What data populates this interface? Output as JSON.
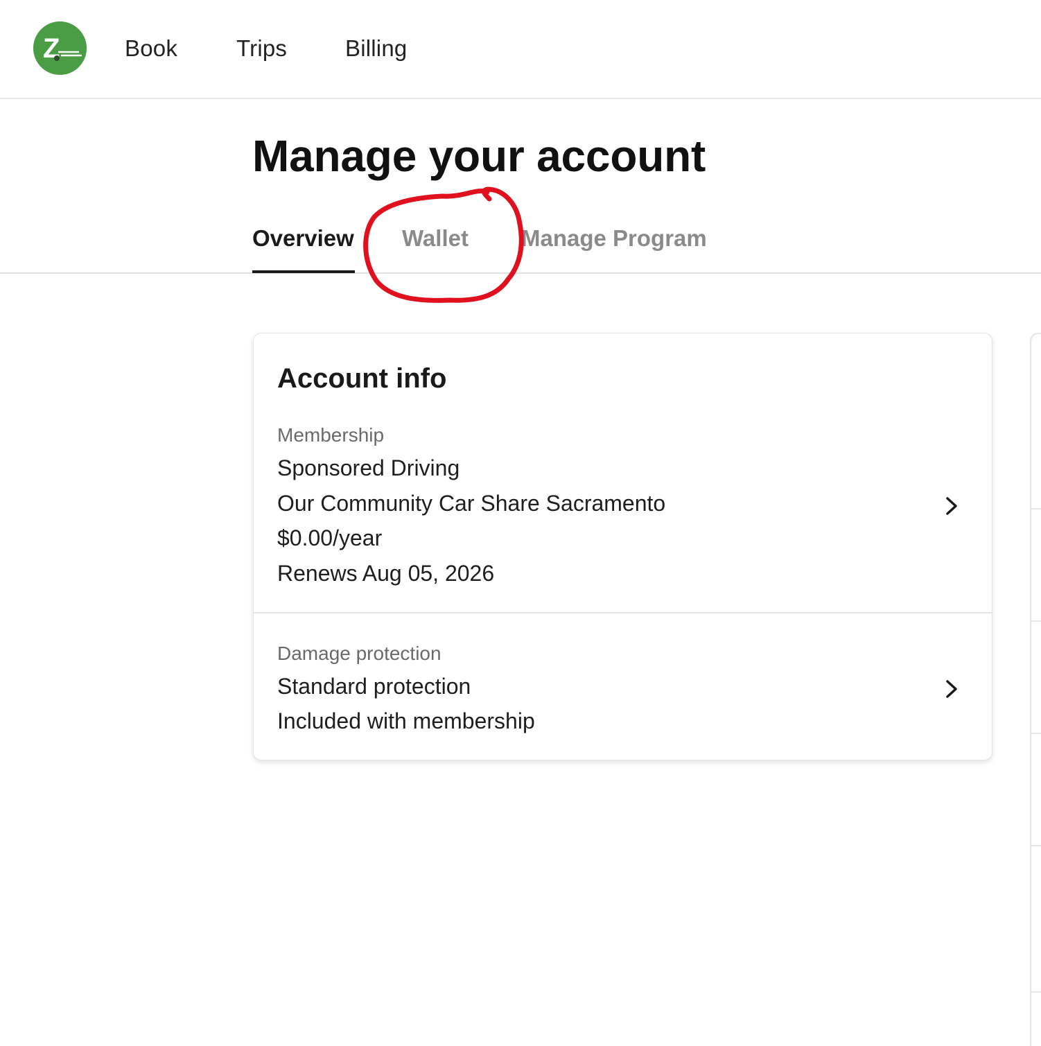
{
  "nav": {
    "logo_letter": "Z",
    "items": [
      {
        "label": "Book"
      },
      {
        "label": "Trips"
      },
      {
        "label": "Billing"
      }
    ]
  },
  "page": {
    "title": "Manage your account"
  },
  "tabs": [
    {
      "label": "Overview",
      "active": true
    },
    {
      "label": "Wallet",
      "active": false
    },
    {
      "label": "Manage Program",
      "active": false
    }
  ],
  "annotation": {
    "type": "red-circle",
    "color": "#e0101e",
    "target": "Wallet"
  },
  "account_info": {
    "title": "Account info",
    "membership": {
      "label": "Membership",
      "lines": [
        "Sponsored Driving",
        "Our Community Car Share Sacramento",
        "$0.00/year",
        "Renews Aug 05, 2026"
      ]
    },
    "damage_protection": {
      "label": "Damage protection",
      "lines": [
        "Standard protection",
        "Included with membership"
      ]
    }
  },
  "colors": {
    "brand_green": "#4a9d45",
    "active_tab": "#1a1a1a",
    "inactive_tab": "#8a8a8a"
  }
}
